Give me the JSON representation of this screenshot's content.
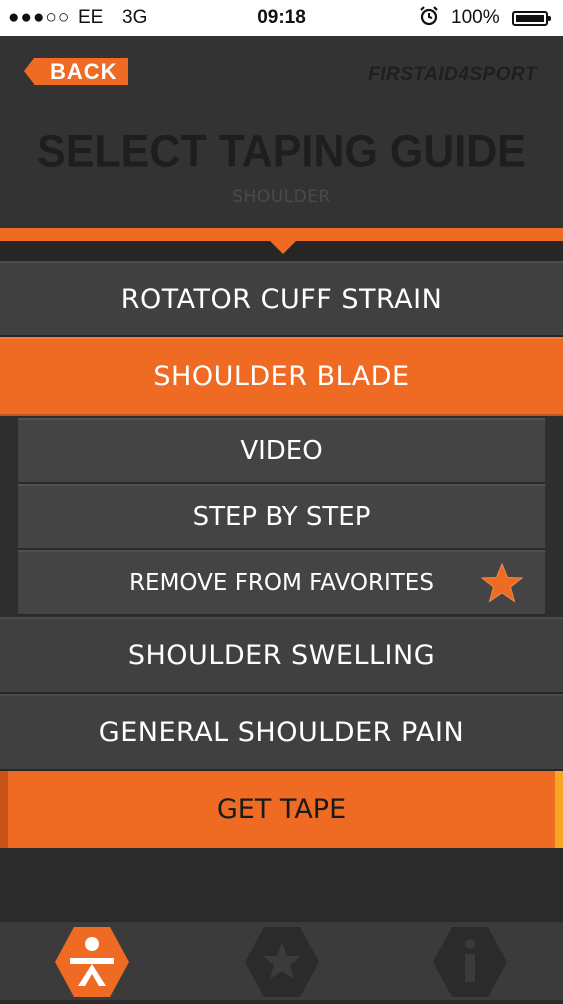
{
  "status_bar": {
    "signal": "●●●○○",
    "carrier": "EE",
    "network": "3G",
    "time": "09:18",
    "battery": "100%"
  },
  "header": {
    "back_label": "BACK",
    "brand": "FIRSTAID4SPORT",
    "title": "SELECT TAPING GUIDE",
    "subtitle": "SHOULDER"
  },
  "menu": {
    "items": [
      {
        "label": "ROTATOR CUFF STRAIN"
      },
      {
        "label": "SHOULDER BLADE"
      },
      {
        "label": "SHOULDER SWELLING"
      },
      {
        "label": "GENERAL SHOULDER PAIN"
      }
    ],
    "sub_items": [
      {
        "label": "VIDEO"
      },
      {
        "label": "STEP BY STEP"
      },
      {
        "label": "REMOVE FROM FAVORITES"
      }
    ]
  },
  "get_tape_label": "GET TAPE",
  "tabbar": {
    "tabs": [
      {
        "icon": "person-icon",
        "active": true
      },
      {
        "icon": "star-icon",
        "active": false
      },
      {
        "icon": "info-icon",
        "active": false
      }
    ]
  },
  "colors": {
    "accent": "#ef6a22",
    "background": "#2b2b2b"
  }
}
